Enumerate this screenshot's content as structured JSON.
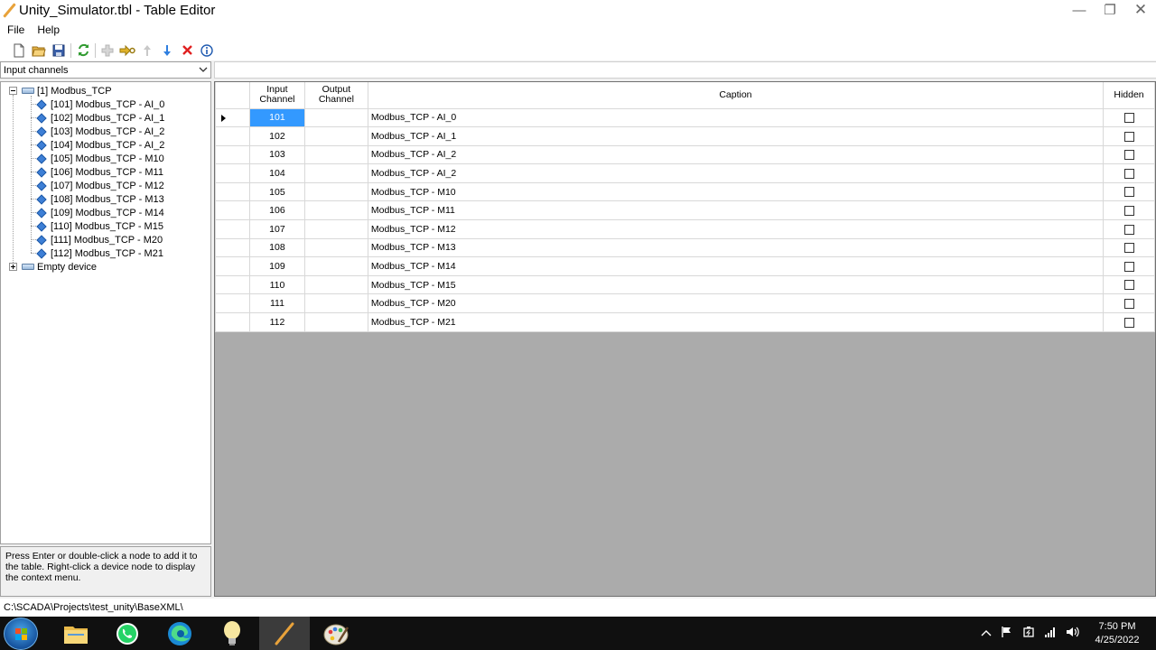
{
  "window": {
    "title": "Unity_Simulator.tbl - Table Editor",
    "controls": [
      "—",
      "❐",
      "✕"
    ]
  },
  "menu": {
    "file": "File",
    "help": "Help"
  },
  "toolbar": {
    "icons": [
      "new-file-icon",
      "open-folder-icon",
      "save-icon",
      "refresh-icon",
      "add-icon",
      "add-range-icon",
      "move-up-icon",
      "move-down-icon",
      "delete-icon",
      "info-icon"
    ]
  },
  "channel_type": {
    "selected": "Input channels"
  },
  "tree": {
    "devices": [
      {
        "label": "[1] Modbus_TCP",
        "expanded": true,
        "channels": [
          "[101] Modbus_TCP - AI_0",
          "[102] Modbus_TCP - AI_1",
          "[103] Modbus_TCP - AI_2",
          "[104] Modbus_TCP - AI_2",
          "[105] Modbus_TCP - M10",
          "[106] Modbus_TCP - M11",
          "[107] Modbus_TCP - M12",
          "[108] Modbus_TCP - M13",
          "[109] Modbus_TCP - M14",
          "[110] Modbus_TCP - M15",
          "[111] Modbus_TCP - M20",
          "[112] Modbus_TCP - M21"
        ]
      },
      {
        "label": "Empty device",
        "expanded": false,
        "channels": []
      }
    ]
  },
  "hint": "Press Enter or double-click a node to add it to the table. Right-click a device node to display the context menu.",
  "grid": {
    "headers": {
      "input_line1": "Input",
      "input_line2": "Channel",
      "output_line1": "Output",
      "output_line2": "Channel",
      "caption": "Caption",
      "hidden": "Hidden"
    },
    "rows": [
      {
        "input": "101",
        "output": "",
        "caption": "Modbus_TCP - AI_0",
        "hidden": false
      },
      {
        "input": "102",
        "output": "",
        "caption": "Modbus_TCP - AI_1",
        "hidden": false
      },
      {
        "input": "103",
        "output": "",
        "caption": "Modbus_TCP - AI_2",
        "hidden": false
      },
      {
        "input": "104",
        "output": "",
        "caption": "Modbus_TCP - AI_2",
        "hidden": false
      },
      {
        "input": "105",
        "output": "",
        "caption": "Modbus_TCP - M10",
        "hidden": false
      },
      {
        "input": "106",
        "output": "",
        "caption": "Modbus_TCP - M11",
        "hidden": false
      },
      {
        "input": "107",
        "output": "",
        "caption": "Modbus_TCP - M12",
        "hidden": false
      },
      {
        "input": "108",
        "output": "",
        "caption": "Modbus_TCP - M13",
        "hidden": false
      },
      {
        "input": "109",
        "output": "",
        "caption": "Modbus_TCP - M14",
        "hidden": false
      },
      {
        "input": "110",
        "output": "",
        "caption": "Modbus_TCP - M15",
        "hidden": false
      },
      {
        "input": "111",
        "output": "",
        "caption": "Modbus_TCP - M20",
        "hidden": false
      },
      {
        "input": "112",
        "output": "",
        "caption": "Modbus_TCP - M21",
        "hidden": false
      }
    ],
    "selected_row": 0,
    "selection_color": "#3399ff"
  },
  "status": {
    "path": "C:\\SCADA\\Projects\\test_unity\\BaseXML\\"
  },
  "taskbar": {
    "apps": [
      "start-button",
      "file-explorer-icon",
      "whatsapp-icon",
      "edge-icon",
      "lightbulb-app-icon",
      "table-editor-icon",
      "paint-icon"
    ],
    "active_app": "table-editor-icon",
    "clock_time": "7:50 PM",
    "clock_date": "4/25/2022"
  }
}
